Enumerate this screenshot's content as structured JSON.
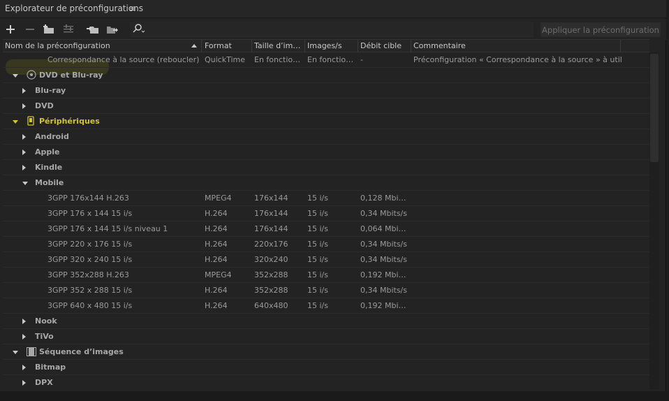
{
  "window": {
    "title": "Explorateur de préconfigurations",
    "menu_icon": "hamburger-icon"
  },
  "toolbar": {
    "buttons": [
      "add-icon",
      "remove-icon",
      "new-folder-icon",
      "settings-icon",
      "import-icon",
      "export-icon",
      "search-icon"
    ],
    "apply_label": "Appliquer la préconfiguration"
  },
  "columns": {
    "name": "Nom de la préconfiguration",
    "format": "Format",
    "size": "Taille d’im…",
    "fps": "Images/s",
    "rate": "Débit cible",
    "comment": "Commentaire"
  },
  "rows": {
    "source_match": {
      "name": "Correspondance à la source (reboucler)",
      "format": "QuickTime",
      "size": "En fonctio…",
      "fps": "En fonctio…",
      "rate": "-",
      "comment": "Préconfiguration « Correspondance à la source » à util…"
    },
    "dvd_bluray": "DVD et Blu-ray",
    "bluray": "Blu-ray",
    "dvd": "DVD",
    "peripheriques": "Périphériques",
    "android": "Android",
    "apple": "Apple",
    "kindle": "Kindle",
    "mobile": "Mobile",
    "mobile_presets": [
      {
        "name": "3GPP 176x144 H.263",
        "format": "MPEG4",
        "size": "176x144",
        "fps": "15 i/s",
        "rate": "0,128 Mbi…"
      },
      {
        "name": "3GPP 176 x 144 15 i/s",
        "format": "H.264",
        "size": "176x144",
        "fps": "15 i/s",
        "rate": "0,34 Mbits/s"
      },
      {
        "name": "3GPP 176 x 144 15 i/s niveau 1",
        "format": "H.264",
        "size": "176x144",
        "fps": "15 i/s",
        "rate": "0,064 Mbi…"
      },
      {
        "name": "3GPP 220 x 176 15 i/s",
        "format": "H.264",
        "size": "220x176",
        "fps": "15 i/s",
        "rate": "0,34 Mbits/s"
      },
      {
        "name": "3GPP 320 x 240 15 i/s",
        "format": "H.264",
        "size": "320x240",
        "fps": "15 i/s",
        "rate": "0,34 Mbits/s"
      },
      {
        "name": "3GPP 352x288 H.263",
        "format": "MPEG4",
        "size": "352x288",
        "fps": "15 i/s",
        "rate": "0,192 Mbi…"
      },
      {
        "name": "3GPP 352 x 288 15 i/s",
        "format": "H.264",
        "size": "352x288",
        "fps": "15 i/s",
        "rate": "0,34 Mbits/s"
      },
      {
        "name": "3GPP 640 x 480 15 i/s",
        "format": "H.264",
        "size": "640x480",
        "fps": "15 i/s",
        "rate": "0,192 Mbi…"
      }
    ],
    "nook": "Nook",
    "tivo": "TiVo",
    "image_sequence": "Séquence d’images",
    "bitmap": "Bitmap",
    "dpx": "DPX"
  },
  "colors": {
    "highlight": "#d2c530",
    "panel_bg": "#232323"
  }
}
